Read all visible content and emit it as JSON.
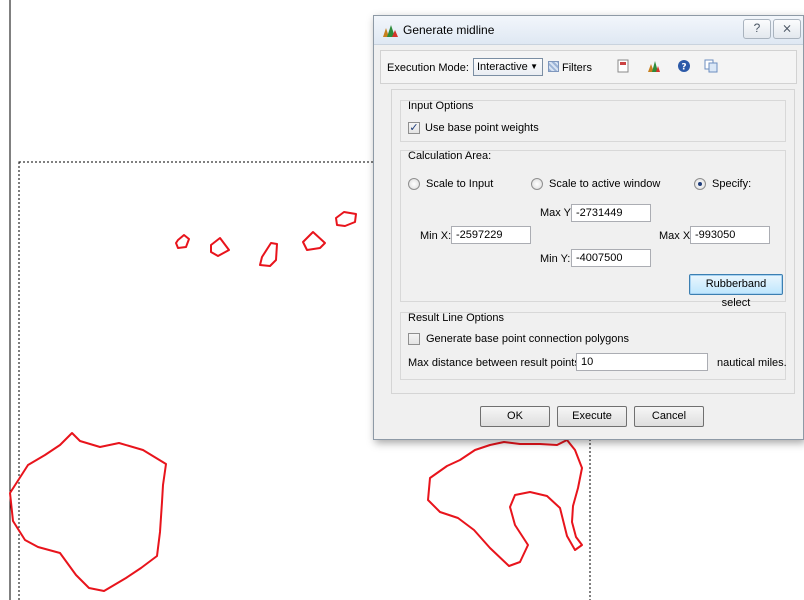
{
  "dialog": {
    "title": "Generate midline",
    "help_glyph": "?",
    "close_glyph": "⨯",
    "toolbar": {
      "execution_mode_label": "Execution Mode:",
      "execution_mode_value": "Interactive",
      "filters_label": "Filters",
      "icons": [
        "document-icon",
        "app-logo-icon",
        "help-icon",
        "copy-icon"
      ]
    },
    "input_options": {
      "title": "Input Options",
      "use_base_point_weights_label": "Use base point weights",
      "use_base_point_weights_checked": true
    },
    "calculation_area": {
      "title": "Calculation Area:",
      "scale_to_input_label": "Scale to Input",
      "scale_to_active_window_label": "Scale to active window",
      "specify_label": "Specify:",
      "selected": "specify",
      "max_y_label": "Max Y:",
      "max_y_value": "-2731449",
      "min_x_label": "Min X:",
      "min_x_value": "-2597229",
      "max_x_label": "Max X:",
      "max_x_value": "-993050",
      "min_y_label": "Min Y:",
      "min_y_value": "-4007500",
      "rubberband_label": "Rubberband select"
    },
    "result_line_options": {
      "title": "Result Line Options",
      "generate_polygons_label": "Generate base point connection polygons",
      "generate_polygons_checked": false,
      "max_distance_label": "Max distance between result points:",
      "max_distance_value": "10",
      "unit_label": "nautical miles."
    },
    "buttons": {
      "ok": "OK",
      "execute": "Execute",
      "cancel": "Cancel"
    }
  },
  "colors": {
    "polygon_stroke": "#e8141c",
    "dialog_bg": "#f0f0f0"
  }
}
